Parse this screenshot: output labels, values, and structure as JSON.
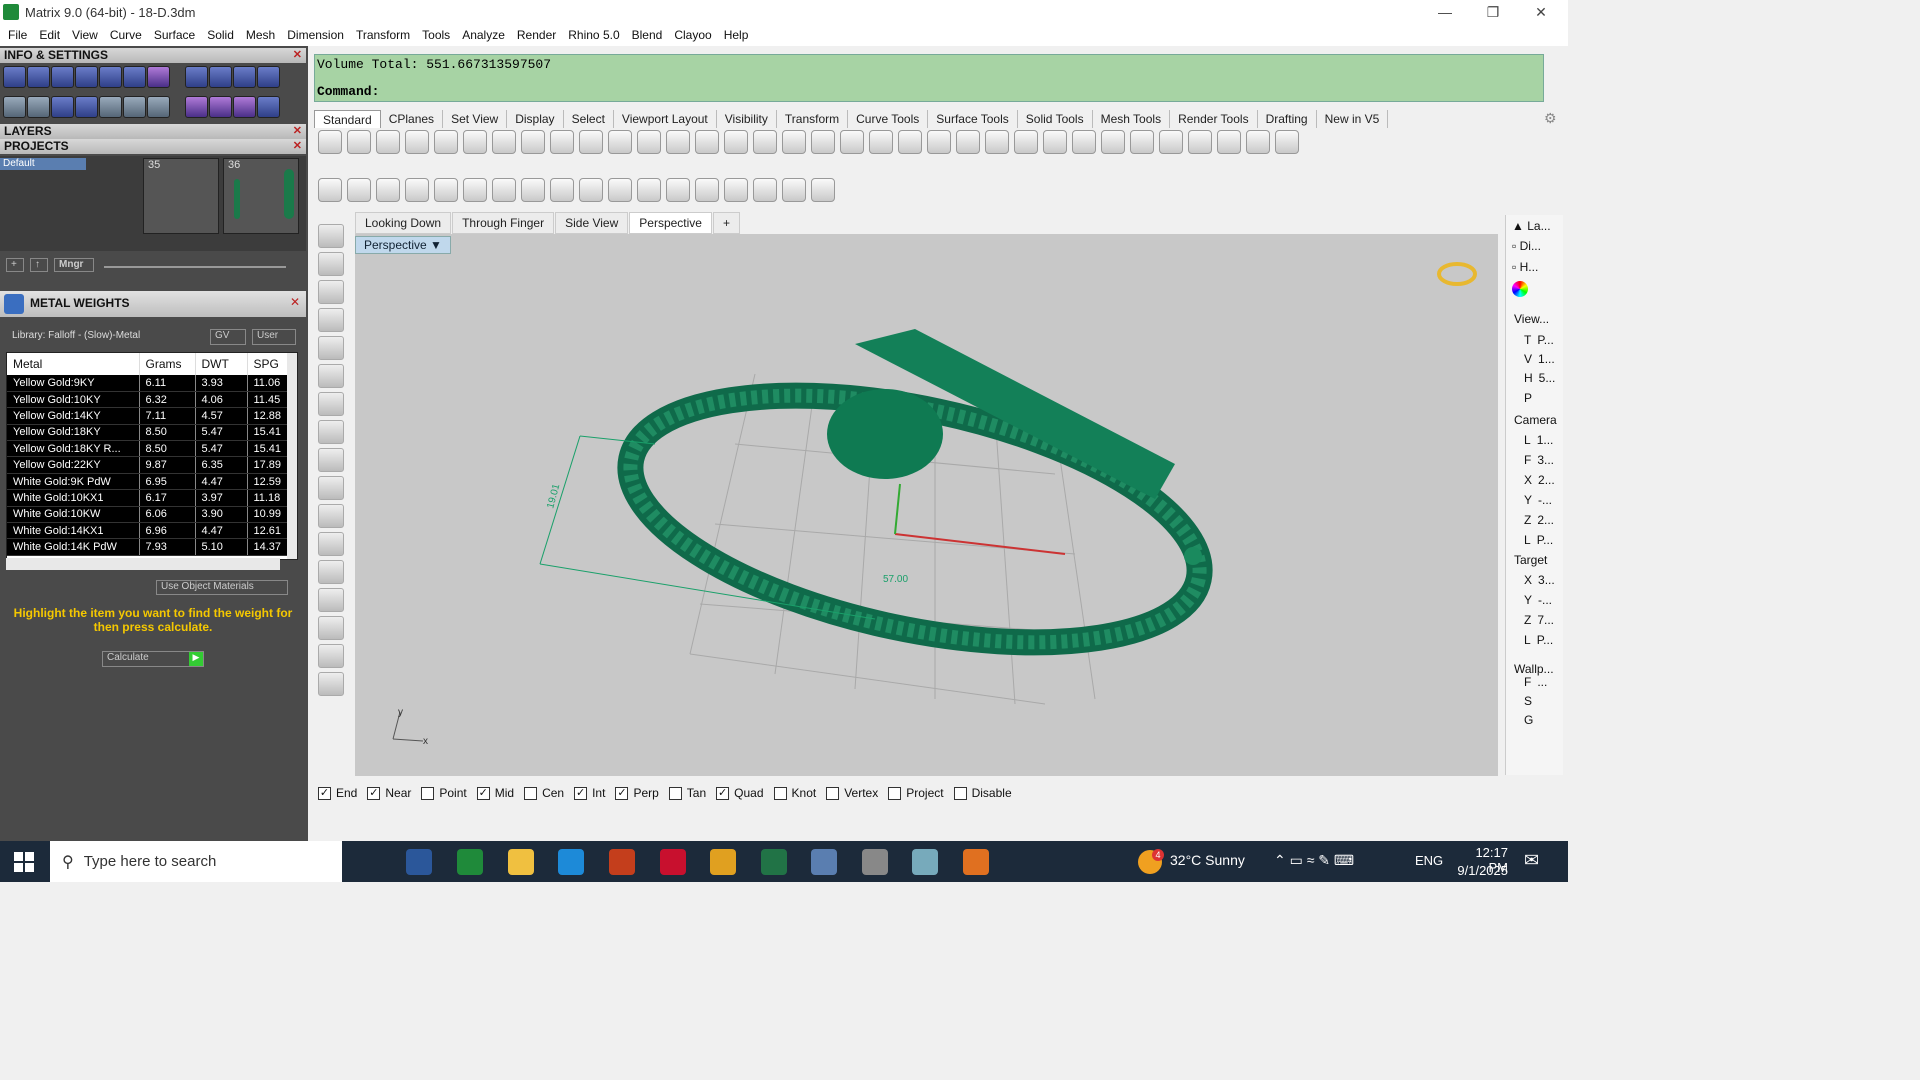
{
  "title": "Matrix 9.0 (64-bit) - 18-D.3dm",
  "menu": [
    "File",
    "Edit",
    "View",
    "Curve",
    "Surface",
    "Solid",
    "Mesh",
    "Dimension",
    "Transform",
    "Tools",
    "Analyze",
    "Render",
    "Rhino 5.0",
    "Blend",
    "Clayoo",
    "Help"
  ],
  "panels": {
    "info": "INFO & SETTINGS",
    "layers": "LAYERS",
    "projects": "PROJECTS",
    "default": "Default",
    "t35": "35",
    "t36": "36",
    "mngr": "Mngr"
  },
  "metal": {
    "title": "METAL WEIGHTS",
    "library": "Library: Falloff - (Slow)-Metal",
    "gv": "GV",
    "user": "User",
    "headers": [
      "Metal",
      "Grams",
      "DWT",
      "SPG"
    ],
    "rows": [
      [
        "Yellow Gold:9KY",
        "6.11",
        "3.93",
        "11.06"
      ],
      [
        "Yellow Gold:10KY",
        "6.32",
        "4.06",
        "11.45"
      ],
      [
        "Yellow Gold:14KY",
        "7.11",
        "4.57",
        "12.88"
      ],
      [
        "Yellow Gold:18KY",
        "8.50",
        "5.47",
        "15.41"
      ],
      [
        "Yellow Gold:18KY R...",
        "8.50",
        "5.47",
        "15.41"
      ],
      [
        "Yellow Gold:22KY",
        "9.87",
        "6.35",
        "17.89"
      ],
      [
        "White Gold:9K PdW",
        "6.95",
        "4.47",
        "12.59"
      ],
      [
        "White Gold:10KX1",
        "6.17",
        "3.97",
        "11.18"
      ],
      [
        "White Gold:10KW",
        "6.06",
        "3.90",
        "10.99"
      ],
      [
        "White Gold:14KX1",
        "6.96",
        "4.47",
        "12.61"
      ],
      [
        "White Gold:14K PdW",
        "7.93",
        "5.10",
        "14.37"
      ]
    ],
    "use_obj": "Use Object Materials",
    "hint": "Highlight the item you want to find the weight for then press calculate.",
    "calc": "Calculate"
  },
  "cmd": {
    "line1": "Volume Total: 551.667313597507",
    "line2": "Command:"
  },
  "tabs": [
    "Standard",
    "CPlanes",
    "Set View",
    "Display",
    "Select",
    "Viewport Layout",
    "Visibility",
    "Transform",
    "Curve Tools",
    "Surface Tools",
    "Solid Tools",
    "Mesh Tools",
    "Render Tools",
    "Drafting",
    "New in V5"
  ],
  "viewtabs": [
    "Looking Down",
    "Through Finger",
    "Side View",
    "Perspective"
  ],
  "viewport_label": "Perspective",
  "dims": {
    "d1": "19.01",
    "d2": "57.00"
  },
  "snaps": [
    [
      "End",
      true
    ],
    [
      "Near",
      true
    ],
    [
      "Point",
      false
    ],
    [
      "Mid",
      true
    ],
    [
      "Cen",
      false
    ],
    [
      "Int",
      true
    ],
    [
      "Perp",
      true
    ],
    [
      "Tan",
      false
    ],
    [
      "Quad",
      true
    ],
    [
      "Knot",
      false
    ],
    [
      "Vertex",
      false
    ],
    [
      "Project",
      false
    ],
    [
      "Disable",
      false
    ]
  ],
  "rpanel": {
    "la": "La...",
    "di": "Di...",
    "h": "H...",
    "view": "View...",
    "camera": "Camera",
    "target": "Target",
    "wallp": "Wallp...",
    "rows": [
      "T",
      "V",
      "H",
      "P",
      "L",
      "F",
      "X",
      "Y",
      "Z",
      "L",
      "X",
      "Y",
      "Z",
      "L",
      "F",
      "S",
      "G"
    ],
    "vals": [
      "P...",
      "1...",
      "5...",
      "",
      "1...",
      "3...",
      "2...",
      "-...",
      "2...",
      "P...",
      "3...",
      "-...",
      "7...",
      "P...",
      "...",
      "",
      ""
    ]
  },
  "taskbar": {
    "search": "Type here to search",
    "weather": "32°C  Sunny",
    "lang": "ENG",
    "time": "12:17 PM",
    "date": "9/1/2025",
    "badge": "4"
  }
}
